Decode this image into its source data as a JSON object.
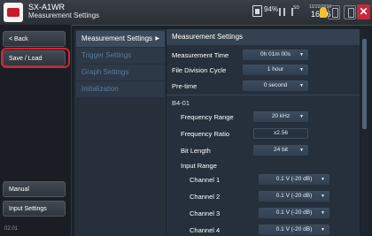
{
  "app": {
    "title": "SX-A1WR",
    "subtitle": "Measurement Settings"
  },
  "status": {
    "battery": "94%",
    "sd_text": "SD",
    "date": "12/22/2016",
    "time": "16:56"
  },
  "colors": {
    "accent_highlight": "#d6232e",
    "close_button": "#c8283a",
    "tag": "#f2c12e"
  },
  "left_nav": {
    "back": "< Back",
    "save_load": "Save / Load",
    "manual": "Manual",
    "input_settings": "Input Settings",
    "footer_number": "02.01"
  },
  "categories": [
    {
      "label": "Measurement Settings",
      "arrow": "▶"
    },
    {
      "label": "Trigger Settings"
    },
    {
      "label": "Graph Settings"
    },
    {
      "label": "Initialization"
    }
  ],
  "panel": {
    "header": "Measurement Settings",
    "measurement_time_label": "Measurement Time",
    "measurement_time_value": "0h 01m 00s",
    "file_division_label": "File Division Cycle",
    "file_division_value": "1 hour",
    "pretime_label": "Pre-time",
    "pretime_value": "0 second",
    "section": "B4-01",
    "frequency_range_label": "Frequency Range",
    "frequency_range_value": "20 kHz",
    "frequency_ratio_label": "Frequency Ratio",
    "frequency_ratio_value": "x2.56",
    "bit_length_label": "Bit Length",
    "bit_length_value": "24 bit",
    "input_range_label": "Input Range",
    "channels": [
      {
        "label": "Channel 1",
        "value": "0.1 V (-20 dB)"
      },
      {
        "label": "Channel 2",
        "value": "0.1 V (-20 dB)"
      },
      {
        "label": "Channel 3",
        "value": "0.1 V (-20 dB)"
      },
      {
        "label": "Channel 4",
        "value": "0.1 V (-20 dB)"
      }
    ]
  }
}
